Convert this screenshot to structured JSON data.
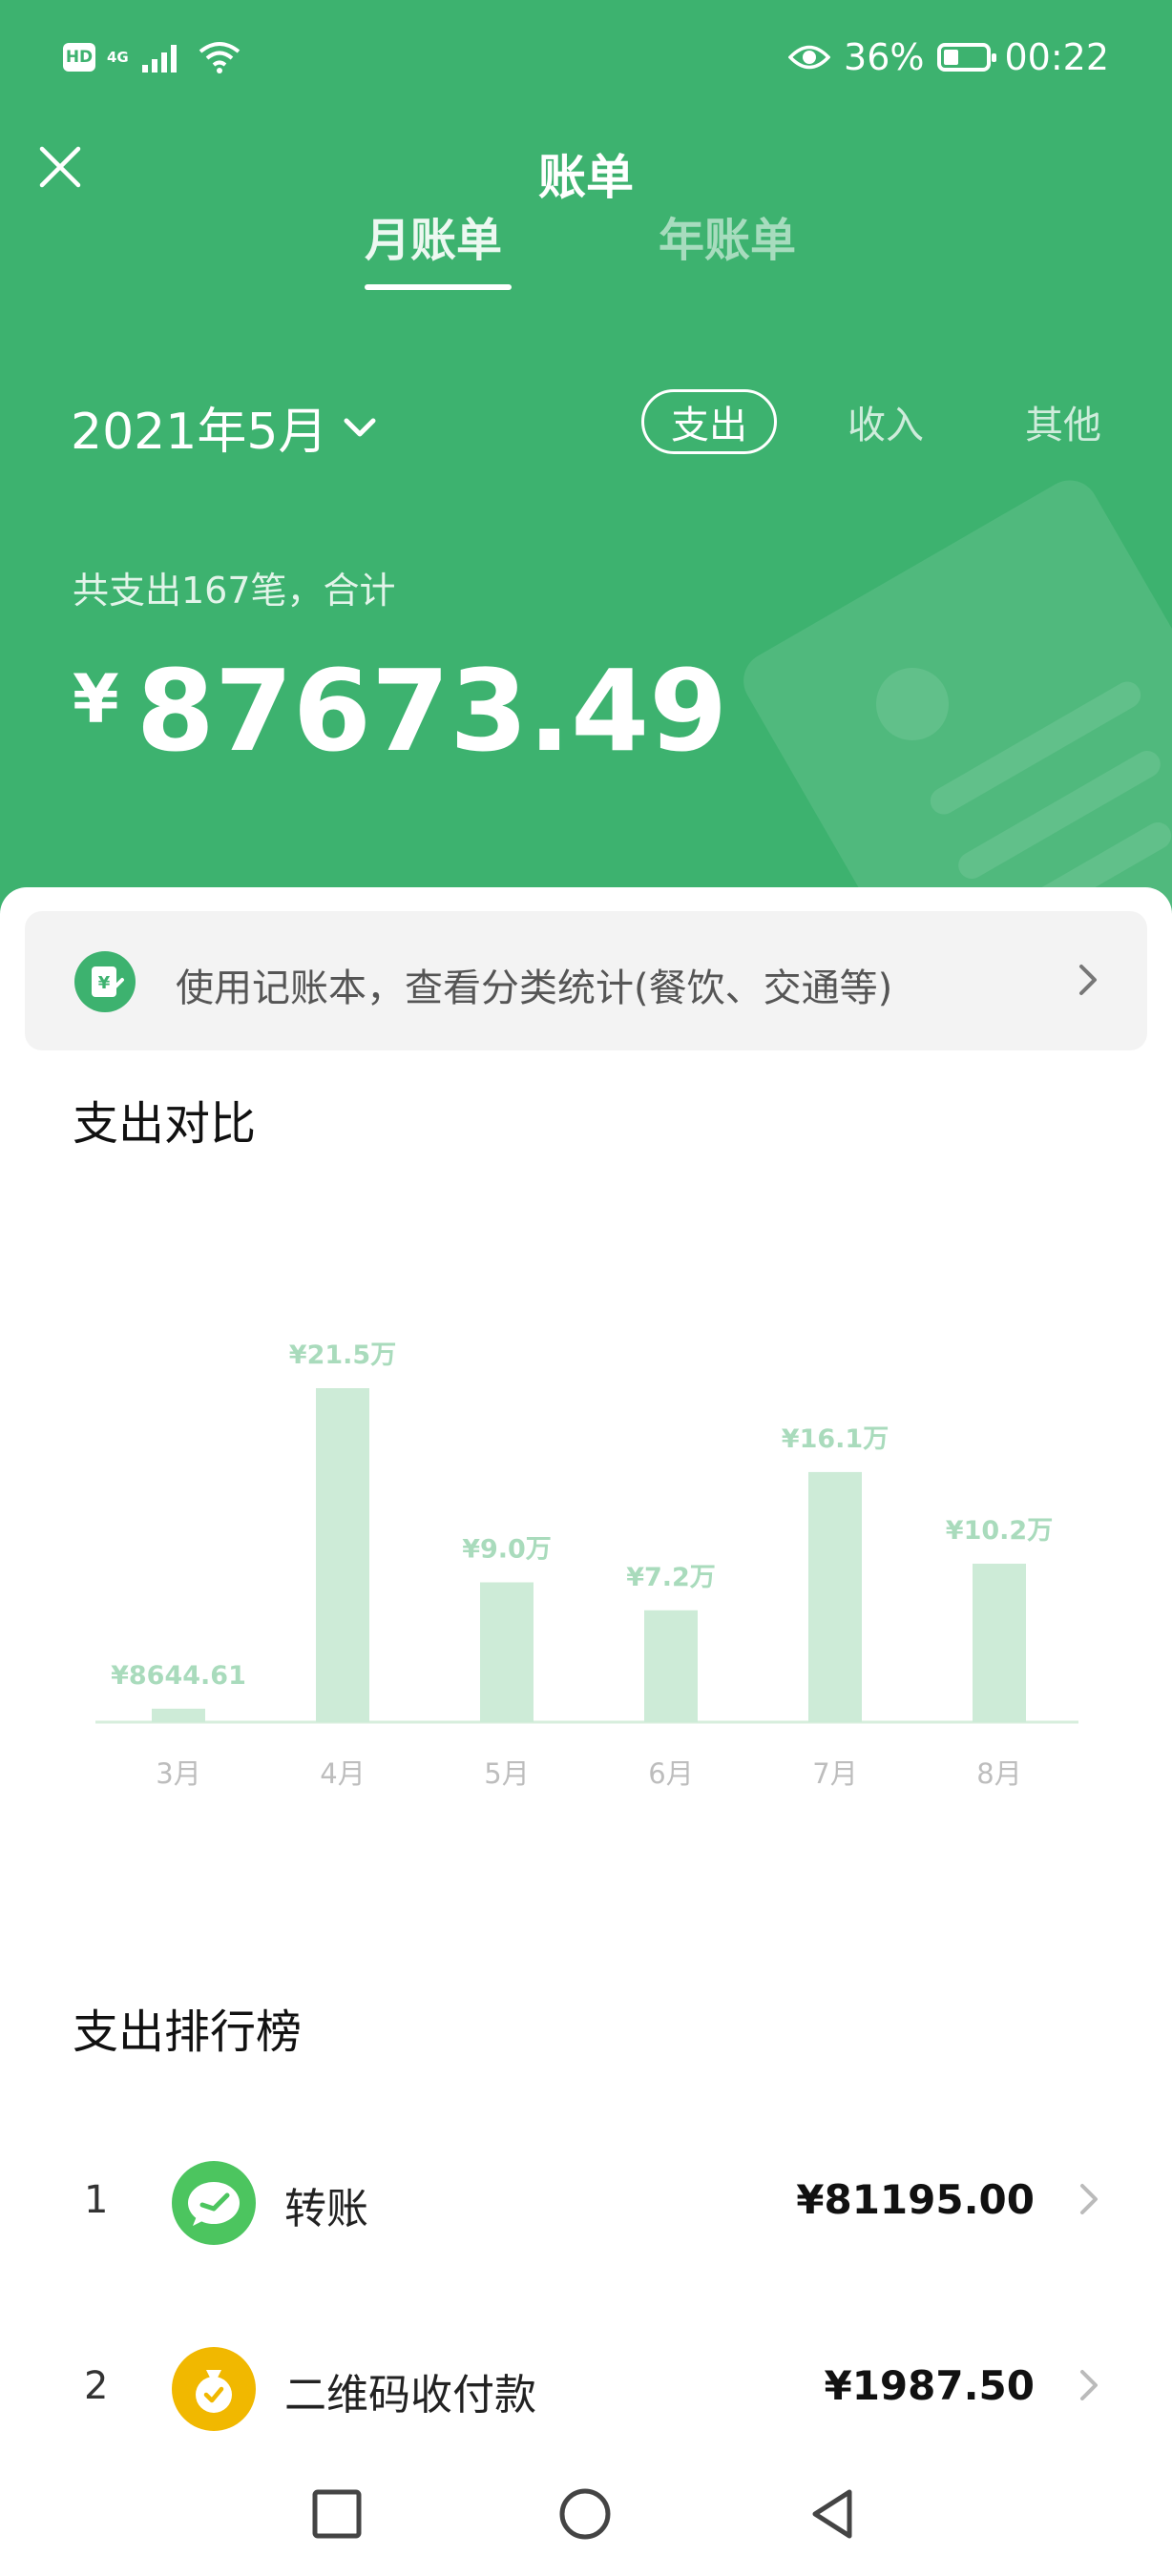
{
  "status_bar": {
    "hd": "HD",
    "network": "4G",
    "battery": "36%",
    "time": "00:22",
    "battery_level": 0.36
  },
  "header": {
    "title": "账单",
    "tabs": [
      {
        "label": "月账单",
        "active": true
      },
      {
        "label": "年账单",
        "active": false
      }
    ]
  },
  "filter": {
    "month": "2021年5月",
    "types": [
      {
        "label": "支出",
        "active": true
      },
      {
        "label": "收入",
        "active": false
      },
      {
        "label": "其他",
        "active": false
      }
    ]
  },
  "summary": {
    "label": "共支出167笔，合计",
    "currency": "¥",
    "amount": "87673.49"
  },
  "banner": {
    "text": "使用记账本，查看分类统计(餐饮、交通等)"
  },
  "comparison": {
    "title": "支出对比"
  },
  "chart_data": {
    "type": "bar",
    "categories": [
      "3月",
      "4月",
      "5月",
      "6月",
      "7月",
      "8月"
    ],
    "values": [
      8644.61,
      215000,
      90000,
      72000,
      161000,
      102000
    ],
    "labels": [
      "¥8644.61",
      "¥21.5万",
      "¥9.0万",
      "¥7.2万",
      "¥16.1万",
      "¥10.2万"
    ],
    "bar_color": "#cdebd7",
    "label_color": "#a9dbbc"
  },
  "ranking": {
    "title": "支出排行榜",
    "items": [
      {
        "rank": "1",
        "name": "转账",
        "amount": "¥81195.00",
        "icon": "transfer-icon",
        "color": "#4cc55f"
      },
      {
        "rank": "2",
        "name": "二维码收付款",
        "amount": "¥1987.50",
        "icon": "money-bag-icon",
        "color": "#f1b800"
      }
    ]
  },
  "colors": {
    "primary": "#3db26f"
  }
}
